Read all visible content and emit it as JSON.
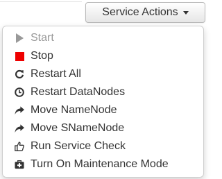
{
  "header": {
    "service_actions_label": "Service Actions"
  },
  "colors": {
    "stop_red": "#ee0000",
    "text": "#333333",
    "disabled_text": "#999999"
  },
  "menu": {
    "items": [
      {
        "label": "Start",
        "icon": "play-icon",
        "disabled": true
      },
      {
        "label": "Stop",
        "icon": "stop-icon",
        "disabled": false
      },
      {
        "label": "Restart All",
        "icon": "refresh-icon",
        "disabled": false
      },
      {
        "label": "Restart DataNodes",
        "icon": "clock-icon",
        "disabled": false
      },
      {
        "label": "Move NameNode",
        "icon": "share-arrow-icon",
        "disabled": false
      },
      {
        "label": "Move SNameNode",
        "icon": "share-arrow-icon",
        "disabled": false
      },
      {
        "label": "Run Service Check",
        "icon": "thumbs-up-icon",
        "disabled": false
      },
      {
        "label": "Turn On Maintenance Mode",
        "icon": "medkit-icon",
        "disabled": false
      }
    ]
  }
}
